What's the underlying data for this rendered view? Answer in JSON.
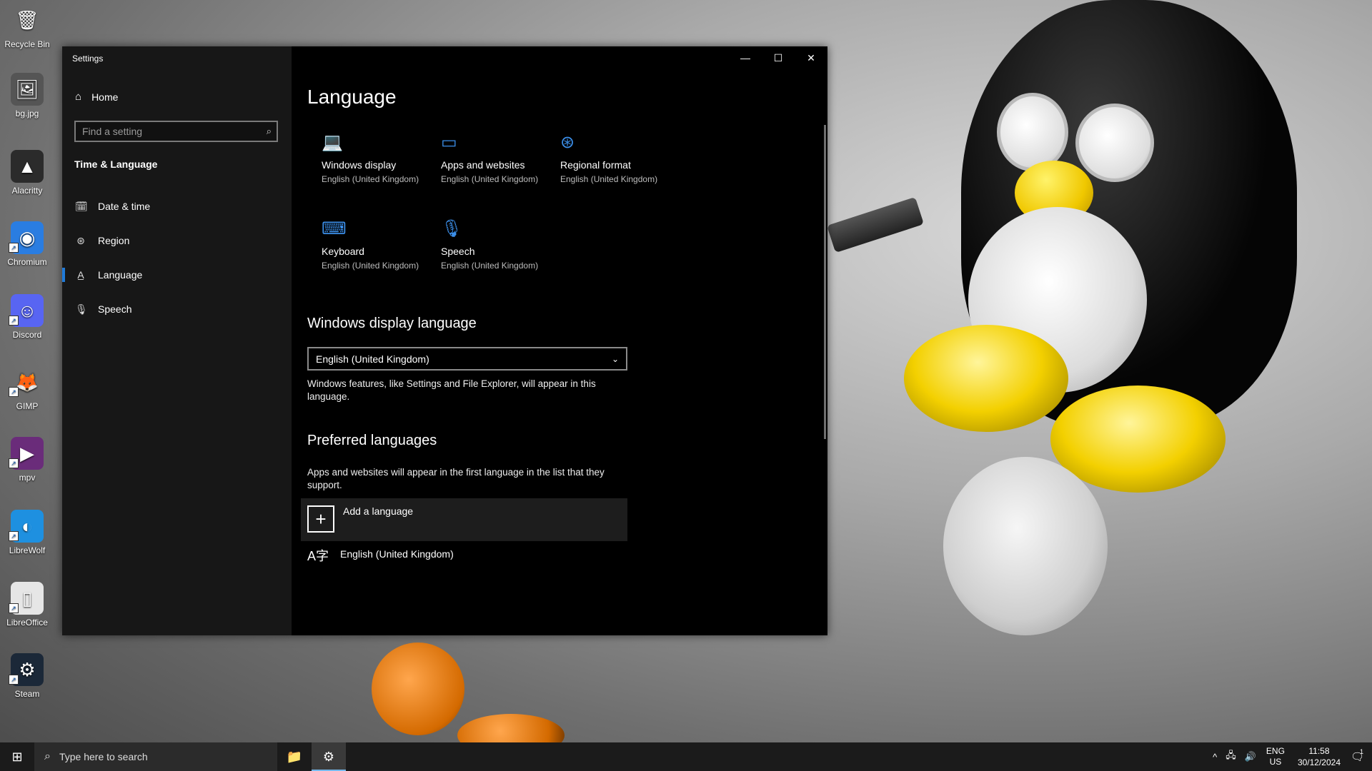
{
  "desktop": {
    "icons": [
      {
        "label": "Recycle Bin",
        "glyph": "🗑",
        "bg": "transparent",
        "shortcut": false
      },
      {
        "label": "bg.jpg",
        "glyph": "🖼",
        "bg": "#555",
        "shortcut": false
      },
      {
        "label": "Alacritty",
        "glyph": "▲",
        "bg": "#2b2b2b",
        "shortcut": false
      },
      {
        "label": "Chromium",
        "glyph": "◉",
        "bg": "#2a7de1",
        "shortcut": true
      },
      {
        "label": "Discord",
        "glyph": "☺",
        "bg": "#5865f2",
        "shortcut": true
      },
      {
        "label": "GIMP",
        "glyph": "🦊",
        "bg": "transparent",
        "shortcut": true
      },
      {
        "label": "mpv",
        "glyph": "▶",
        "bg": "#6a2c7a",
        "shortcut": true
      },
      {
        "label": "LibreWolf",
        "glyph": "◐",
        "bg": "#1e90e0",
        "shortcut": true
      },
      {
        "label": "LibreOffice",
        "glyph": "▯",
        "bg": "#e6e6e6",
        "shortcut": true
      },
      {
        "label": "Steam",
        "glyph": "⚙",
        "bg": "#1b2838",
        "shortcut": true
      }
    ]
  },
  "window": {
    "title": "Settings",
    "controls": {
      "minimize": "—",
      "maximize": "☐",
      "close": "✕"
    }
  },
  "sidebar": {
    "home": "Home",
    "search_placeholder": "Find a setting",
    "section": "Time & Language",
    "items": [
      {
        "label": "Date & time",
        "icon": "clock-icon",
        "glyph": "🗓"
      },
      {
        "label": "Region",
        "icon": "globe-icon",
        "glyph": "⊛"
      },
      {
        "label": "Language",
        "icon": "language-icon",
        "glyph": "A̲"
      },
      {
        "label": "Speech",
        "icon": "microphone-icon",
        "glyph": "🎙"
      }
    ],
    "active_index": 2
  },
  "content": {
    "title": "Language",
    "tiles": [
      {
        "name": "Windows display",
        "sub": "English (United Kingdom)",
        "glyph": "💻",
        "icon": "laptop-icon"
      },
      {
        "name": "Apps and websites",
        "sub": "English (United Kingdom)",
        "glyph": "▭",
        "icon": "browser-window-icon"
      },
      {
        "name": "Regional format",
        "sub": "English (United Kingdom)",
        "glyph": "⊛",
        "icon": "regional-globe-icon"
      },
      {
        "name": "Keyboard",
        "sub": "English (United Kingdom)",
        "glyph": "⌨",
        "icon": "keyboard-icon"
      },
      {
        "name": "Speech",
        "sub": "English (United Kingdom)",
        "glyph": "🎙",
        "icon": "microphone-icon"
      }
    ],
    "display_language": {
      "heading": "Windows display language",
      "selected": "English (United Kingdom)",
      "description": "Windows features, like Settings and File Explorer, will appear in this language."
    },
    "preferred": {
      "heading": "Preferred languages",
      "description": "Apps and websites will appear in the first language in the list that they support.",
      "add_label": "Add a language",
      "languages": [
        "English (United Kingdom)"
      ]
    }
  },
  "taskbar": {
    "search_placeholder": "Type here to search",
    "apps": [
      {
        "name": "File Explorer",
        "glyph": "📁",
        "running": false,
        "active": false
      },
      {
        "name": "Settings",
        "glyph": "⚙",
        "running": true,
        "active": true
      }
    ],
    "tray": {
      "lang_top": "ENG",
      "lang_bottom": "US",
      "time": "11:58",
      "date": "30/12/2024",
      "notification_count": "1"
    }
  }
}
